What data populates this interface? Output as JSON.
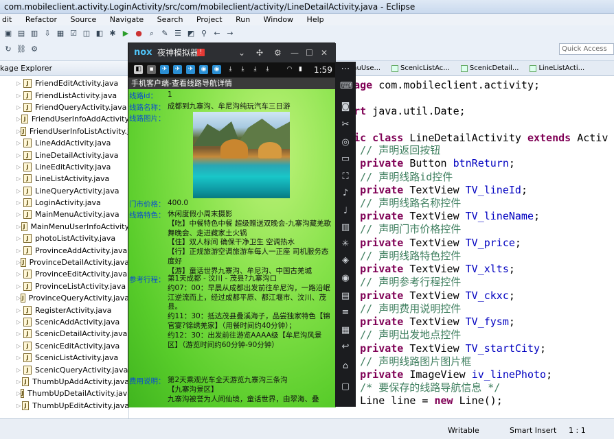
{
  "window": {
    "title": "com.mobileclient.activity.LoginActivity/src/com/mobileclient/activity/LineDetailActivity.java - Eclipse"
  },
  "menu": [
    "dit",
    "Refactor",
    "Source",
    "Navigate",
    "Search",
    "Project",
    "Run",
    "Window",
    "Help"
  ],
  "toolbar": {
    "quick_access": "Quick Access"
  },
  "explorer": {
    "title": "kage Explorer",
    "files": [
      "FriendEditActivity.java",
      "FriendListActivity.java",
      "FriendQueryActivity.java",
      "FriendUserInfoAddActivity",
      "FriendUserInfoListActivity.j",
      "LineAddActivity.java",
      "LineDetailActivity.java",
      "LineEditActivity.java",
      "LineListActivity.java",
      "LineQueryActivity.java",
      "LoginActivity.java",
      "MainMenuActivity.java",
      "MainMenuUserInfoActivity",
      "photoListActivity.java",
      "ProvinceAddActivity.java",
      "ProvinceDetailActivity.java",
      "ProvinceEditActivity.java",
      "ProvinceListActivity.java",
      "ProvinceQueryActivity.java",
      "RegisterActivity.java",
      "ScenicAddActivity.java",
      "ScenicDetailActivity.java",
      "ScenicEditActivity.java",
      "ScenicListActivity.java",
      "ScenicQueryActivity.java",
      "ThumbUpAddActivity.java",
      "ThumbUpDetailActivity.java",
      "ThumbUpEditActivity.java"
    ]
  },
  "editor": {
    "tabs": [
      "enuUse...",
      "ScenicListAc...",
      "ScenicDetail...",
      "LineListActi..."
    ],
    "lines": [
      {
        "parts": [
          [
            "kw",
            "ackage"
          ],
          [
            "tp",
            " com.mobileclient.activity;"
          ]
        ]
      },
      {
        "parts": []
      },
      {
        "parts": [
          [
            "kw",
            "mport"
          ],
          [
            "tp",
            " java.util.Date;"
          ]
        ]
      },
      {
        "parts": []
      },
      {
        "parts": [
          [
            "kw",
            "ublic class"
          ],
          [
            "tp",
            " LineDetailActivity "
          ],
          [
            "kw",
            "extends"
          ],
          [
            "tp",
            " Activ"
          ]
        ]
      },
      {
        "parts": [
          [
            "cm",
            "    // 声明返回按钮"
          ]
        ]
      },
      {
        "parts": [
          [
            "kw",
            "    private"
          ],
          [
            "tp",
            " Button "
          ],
          [
            "fd",
            "btnReturn"
          ],
          [
            "tp",
            ";"
          ]
        ]
      },
      {
        "parts": [
          [
            "cm",
            "    // 声明线路id控件"
          ]
        ]
      },
      {
        "parts": [
          [
            "kw",
            "    private"
          ],
          [
            "tp",
            " TextView "
          ],
          [
            "fd",
            "TV_lineId"
          ],
          [
            "tp",
            ";"
          ]
        ]
      },
      {
        "parts": [
          [
            "cm",
            "    // 声明线路名称控件"
          ]
        ]
      },
      {
        "parts": [
          [
            "kw",
            "    private"
          ],
          [
            "tp",
            " TextView "
          ],
          [
            "fd",
            "TV_lineName"
          ],
          [
            "tp",
            ";"
          ]
        ]
      },
      {
        "parts": [
          [
            "cm",
            "    // 声明门市价格控件"
          ]
        ]
      },
      {
        "parts": [
          [
            "kw",
            "    private"
          ],
          [
            "tp",
            " TextView "
          ],
          [
            "fd",
            "TV_price"
          ],
          [
            "tp",
            ";"
          ]
        ]
      },
      {
        "parts": [
          [
            "cm",
            "    // 声明线路特色控件"
          ]
        ]
      },
      {
        "parts": [
          [
            "kw",
            "    private"
          ],
          [
            "tp",
            " TextView "
          ],
          [
            "fd",
            "TV_xlts"
          ],
          [
            "tp",
            ";"
          ]
        ]
      },
      {
        "parts": [
          [
            "cm",
            "    // 声明参考行程控件"
          ]
        ]
      },
      {
        "parts": [
          [
            "kw",
            "    private"
          ],
          [
            "tp",
            " TextView "
          ],
          [
            "fd",
            "TV_ckxc"
          ],
          [
            "tp",
            ";"
          ]
        ]
      },
      {
        "parts": [
          [
            "cm",
            "    // 声明费用说明控件"
          ]
        ]
      },
      {
        "parts": [
          [
            "kw",
            "    private"
          ],
          [
            "tp",
            " TextView "
          ],
          [
            "fd",
            "TV_fysm"
          ],
          [
            "tp",
            ";"
          ]
        ]
      },
      {
        "parts": [
          [
            "cm",
            "    // 声明出发地点控件"
          ]
        ]
      },
      {
        "parts": [
          [
            "kw",
            "    private"
          ],
          [
            "tp",
            " TextView "
          ],
          [
            "fd",
            "TV_startCity"
          ],
          [
            "tp",
            ";"
          ]
        ]
      },
      {
        "parts": [
          [
            "cm",
            "    // 声明线路图片图片框"
          ]
        ]
      },
      {
        "parts": [
          [
            "kw",
            "    private"
          ],
          [
            "tp",
            " ImageView "
          ],
          [
            "fd",
            "iv_linePhoto"
          ],
          [
            "tp",
            ";"
          ]
        ]
      },
      {
        "parts": [
          [
            "cm",
            "    /* 要保存的线路导航信息 */"
          ]
        ]
      },
      {
        "parts": [
          [
            "tp",
            "    Line line = "
          ],
          [
            "kw",
            "new"
          ],
          [
            "tp",
            " Line();"
          ]
        ]
      }
    ]
  },
  "status": {
    "writable": "Writable",
    "insert": "Smart Insert",
    "pos": "1 : 1"
  },
  "emulator": {
    "logo": "nox",
    "title": "夜神模拟器",
    "badge": "!",
    "clock": "1:59",
    "app_title": "手机客户端-查看线路导航详情",
    "fields": {
      "id_label": "线路id：",
      "id_value": "1",
      "name_label": "线路名称：",
      "name_value": "成都到九寨沟、牟尼沟纯玩汽车三日游",
      "photo_label": "线路图片：",
      "price_label": "门市价格：",
      "price_value": "400.0",
      "feature_label": "线路特色：",
      "feature_value": "休闲度假小周末摄影\n【吃】中餐特色中餐 超级赠送双晚会-九寨沟藏羌歌舞晚会、走进藏家土火锅\n【住】双人标间 确保干净卫生 空调热水\n【行】正规旅游空调旅游车每人一正座 司机服务态度好\n【游】童话世界九寨沟、牟尼沟、中国古羌城",
      "route_label": "参考行程：",
      "route_value": "第1天成都 - 汶川 - 茂县?九寨沟口\n约07：00：早晨从成都出发前往牟尼沟，一路沿岷江逆流而上，经过成都平原、都江堰市、汶川、茂县。\n约11：30：抵达茂县叠溪海子，品尝独家特色【锦官宴?锦绣羌家】（用餐时间约40分钟）；\n约12：30：出发前往游览AAAA级【牟尼沟风景区】（游览时间约60分钟-90分钟）",
      "fee_label": "费用说明：",
      "fee_value": "第2天乘观光车全天游览九寨沟三条沟\n【九寨沟景区】\n九寨沟被誉为人间仙境，童话世界，由翠海、叠"
    }
  }
}
